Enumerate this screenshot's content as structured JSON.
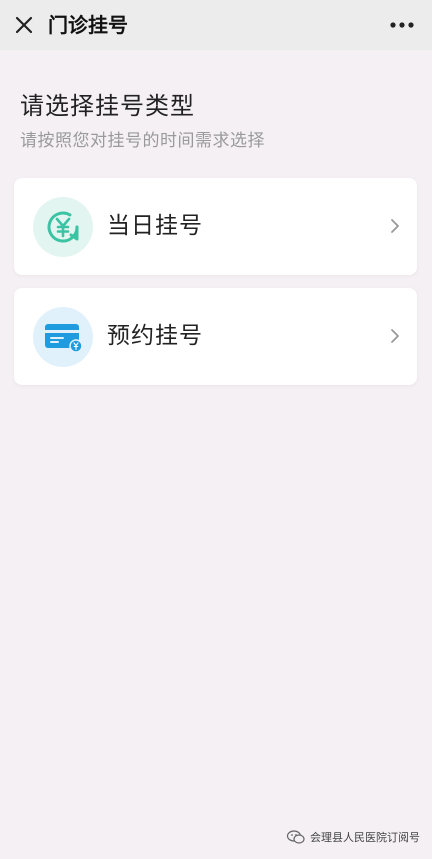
{
  "nav": {
    "title": "门诊挂号",
    "close_icon": "close-icon",
    "more_icon": "more-icon"
  },
  "header": {
    "title": "请选择挂号类型",
    "subtitle": "请按照您对挂号的时间需求选择"
  },
  "options": [
    {
      "label": "当日挂号",
      "icon": "yuan-circle-icon",
      "color": "#3cc3a4"
    },
    {
      "label": "预约挂号",
      "icon": "card-icon",
      "color": "#1f9be0"
    }
  ],
  "footer": {
    "text": "会理县人民医院订阅号",
    "icon": "wechat-subscription-icon"
  },
  "colors": {
    "background": "#f5f0f4",
    "topbar": "#ececec",
    "card": "#ffffff",
    "muted_text": "#9a9a9a"
  }
}
